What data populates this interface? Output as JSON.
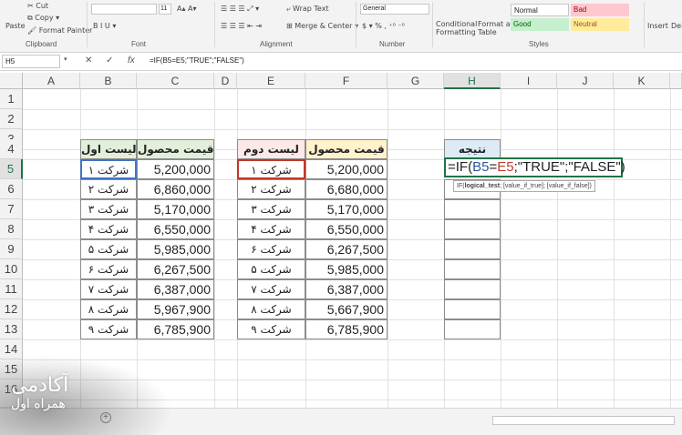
{
  "ribbon": {
    "cut": "Cut",
    "copy": "Copy",
    "format_painter": "Format Painter",
    "paste": "Paste",
    "clipboard": "Clipboard",
    "font_group": "Font",
    "font_size": "11",
    "wrap_text": "Wrap Text",
    "merge_center": "Merge & Center",
    "alignment_group": "Alignment",
    "number_format": "General",
    "number_group": "Number",
    "conditional_formatting": "Conditional",
    "conditional_formatting_2": "Formatting",
    "format_as_table": "Format as",
    "format_as_table_2": "Table",
    "style_normal": "Normal",
    "style_bad": "Bad",
    "style_good": "Good",
    "style_neutral": "Neutral",
    "styles_group": "Styles",
    "insert": "Insert",
    "delete": "Dele"
  },
  "formula_bar": {
    "name_box": "H5",
    "fx": "fx",
    "formula": "=IF(B5=E5;\"TRUE\";\"FALSE\")"
  },
  "columns": [
    "A",
    "B",
    "C",
    "D",
    "E",
    "F",
    "G",
    "H",
    "I",
    "J",
    "K"
  ],
  "rows": [
    "1",
    "2",
    "3",
    "4",
    "5",
    "6",
    "7",
    "8",
    "9",
    "10",
    "11",
    "12",
    "13",
    "14",
    "15",
    "16"
  ],
  "table1": {
    "header_company": "لیست اول",
    "header_price": "قیمت محصول",
    "companies": [
      "شرکت ۱",
      "شرکت ۲",
      "شرکت ۳",
      "شرکت ۴",
      "شرکت ۵",
      "شرکت ۶",
      "شرکت ۷",
      "شرکت ۸",
      "شرکت ۹"
    ],
    "prices": [
      "5,200,000",
      "6,860,000",
      "5,170,000",
      "6,550,000",
      "5,985,000",
      "6,267,500",
      "6,387,000",
      "5,967,900",
      "6,785,900"
    ]
  },
  "table2": {
    "header_company": "لیست دوم",
    "header_price": "قیمت محصول",
    "companies": [
      "شرکت ۱",
      "شرکت ۲",
      "شرکت ۳",
      "شرکت ۴",
      "شرکت ۶",
      "شرکت ۵",
      "شرکت ۷",
      "شرکت ۸",
      "شرکت ۹"
    ],
    "prices": [
      "5,200,000",
      "6,680,000",
      "5,170,000",
      "6,550,000",
      "6,267,500",
      "5,985,000",
      "6,387,000",
      "5,667,900",
      "6,785,900"
    ]
  },
  "result": {
    "header": "نتیجه"
  },
  "edit": {
    "prefix": "=IF(",
    "ref_b": "B5",
    "eq": "=",
    "ref_e": "E5",
    "rest": ";\"TRUE\";\"FALSE\")",
    "tooltip_if": "IF(",
    "tooltip_arg1": "logical_test",
    "tooltip_rest": "; [value_if_true]; [value_if_false])"
  },
  "watermark": {
    "line1": "آکادمی",
    "line2": "همراه اول"
  },
  "colors": {
    "green": "#e2efda",
    "yellow": "#fff2cc",
    "pink": "#fde9e7",
    "blue": "#ddebf7",
    "excel_green": "#217346"
  }
}
